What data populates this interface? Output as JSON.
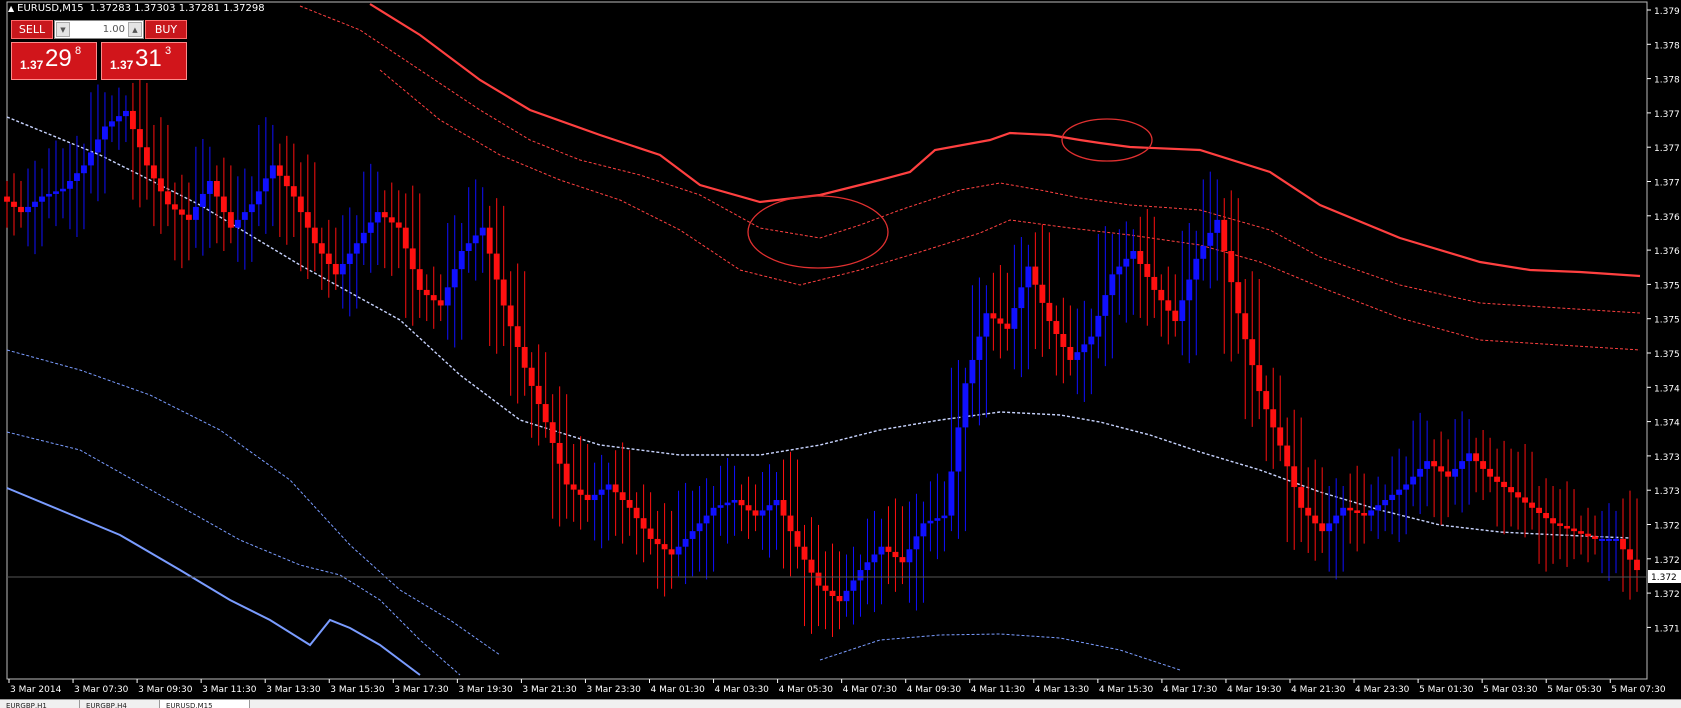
{
  "window": {
    "symbol": "EURUSD,M15",
    "ohlc": "1.37283 1.37303 1.37281 1.37298"
  },
  "trade_panel": {
    "sell_label": "SELL",
    "buy_label": "BUY",
    "lot_value": "1.00",
    "sell_price": {
      "prefix": "1.37",
      "big": "29",
      "sup": "8"
    },
    "buy_price": {
      "prefix": "1.37",
      "big": "31",
      "sup": "3"
    }
  },
  "price_axis": {
    "labels": [
      "1.379",
      "1.378",
      "1.378",
      "1.377",
      "1.377",
      "1.377",
      "1.376",
      "1.376",
      "1.375",
      "1.375",
      "1.375",
      "1.374",
      "1.374",
      "1.373",
      "1.373",
      "1.372",
      "1.372",
      "1.372",
      "1.371"
    ],
    "current_price": "1.372"
  },
  "time_axis": {
    "labels": [
      "3 Mar 2014",
      "3 Mar 07:30",
      "3 Mar 09:30",
      "3 Mar 11:30",
      "3 Mar 13:30",
      "3 Mar 15:30",
      "3 Mar 17:30",
      "3 Mar 19:30",
      "3 Mar 21:30",
      "3 Mar 23:30",
      "4 Mar 01:30",
      "4 Mar 03:30",
      "4 Mar 05:30",
      "4 Mar 07:30",
      "4 Mar 09:30",
      "4 Mar 11:30",
      "4 Mar 13:30",
      "4 Mar 15:30",
      "4 Mar 17:30",
      "4 Mar 19:30",
      "4 Mar 21:30",
      "4 Mar 23:30",
      "5 Mar 01:30",
      "5 Mar 03:30",
      "5 Mar 05:30",
      "5 Mar 07:30"
    ]
  },
  "bottom_tabs": [
    "EURGBP,H1",
    "EURGBP,H4",
    "EURUSD,M15"
  ],
  "colors": {
    "background": "#000000",
    "bull_candle": "#1010ff",
    "bear_candle": "#ff1010",
    "upper_band": "#ff4040",
    "lower_band": "#7a9cff",
    "mid_line": "#c8d4ff",
    "axis": "#ffffff"
  },
  "chart_data": {
    "type": "candlestick",
    "symbol": "EURUSD",
    "timeframe": "M15",
    "ylim": [
      1.3708,
      1.3795
    ],
    "close_path": [
      1.3768,
      1.377,
      1.3771,
      1.3774,
      1.3779,
      1.3781,
      1.3774,
      1.3769,
      1.3767,
      1.3772,
      1.3766,
      1.3769,
      1.3774,
      1.377,
      1.3764,
      1.376,
      1.3764,
      1.3768,
      1.3766,
      1.3758,
      1.3756,
      1.3763,
      1.3766,
      1.3756,
      1.3748,
      1.3741,
      1.3733,
      1.3731,
      1.3733,
      1.373,
      1.3726,
      1.3724,
      1.3727,
      1.373,
      1.3731,
      1.3729,
      1.3731,
      1.3725,
      1.372,
      1.3718,
      1.3722,
      1.3725,
      1.3723,
      1.3728,
      1.3729,
      1.3746,
      1.3755,
      1.3753,
      1.3761,
      1.3754,
      1.3749,
      1.3752,
      1.376,
      1.3763,
      1.3758,
      1.3754,
      1.3762,
      1.3767,
      1.3755,
      1.3745,
      1.3738,
      1.373,
      1.3727,
      1.373,
      1.3729,
      1.3731,
      1.3733,
      1.3736,
      1.3734,
      1.3737,
      1.3734,
      1.3732,
      1.373,
      1.3728,
      1.3727,
      1.3726,
      1.3726,
      1.3722
    ],
    "annotations": [
      {
        "type": "ellipse",
        "note": "price touching middle upper band, 4 Mar 07:30-09:30"
      },
      {
        "type": "ellipse",
        "note": "price touching outer upper band, 4 Mar 15:30"
      }
    ]
  }
}
